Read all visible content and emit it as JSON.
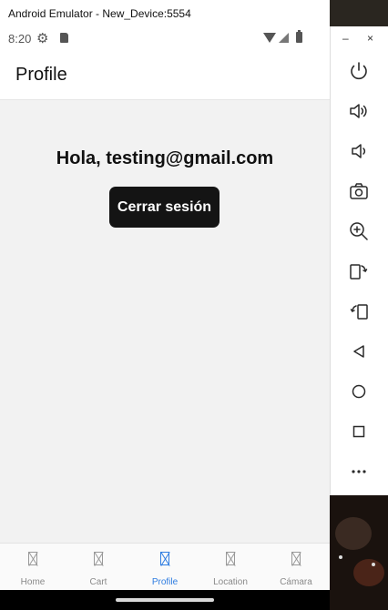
{
  "window": {
    "title": "Android Emulator - New_Device:5554"
  },
  "status_bar": {
    "time": "8:20"
  },
  "app_bar": {
    "title": "Profile"
  },
  "profile": {
    "greeting": "Hola, testing@gmail.com",
    "logout_label": "Cerrar sesión"
  },
  "tabs": [
    {
      "label": "Home",
      "active": false
    },
    {
      "label": "Cart",
      "active": false
    },
    {
      "label": "Profile",
      "active": true
    },
    {
      "label": "Location",
      "active": false
    },
    {
      "label": "Cámara",
      "active": false
    }
  ],
  "emulator_controls": {
    "minimize": "–",
    "close": "×",
    "buttons": [
      "power-icon",
      "volume-up-icon",
      "volume-down-icon",
      "camera-icon",
      "zoom-icon",
      "rotate-left-icon",
      "rotate-right-icon",
      "back-icon",
      "home-icon",
      "overview-icon",
      "more-icon"
    ]
  },
  "colors": {
    "accent": "#2f7de1",
    "button_bg": "#141414",
    "content_bg": "#f2f2f2"
  }
}
